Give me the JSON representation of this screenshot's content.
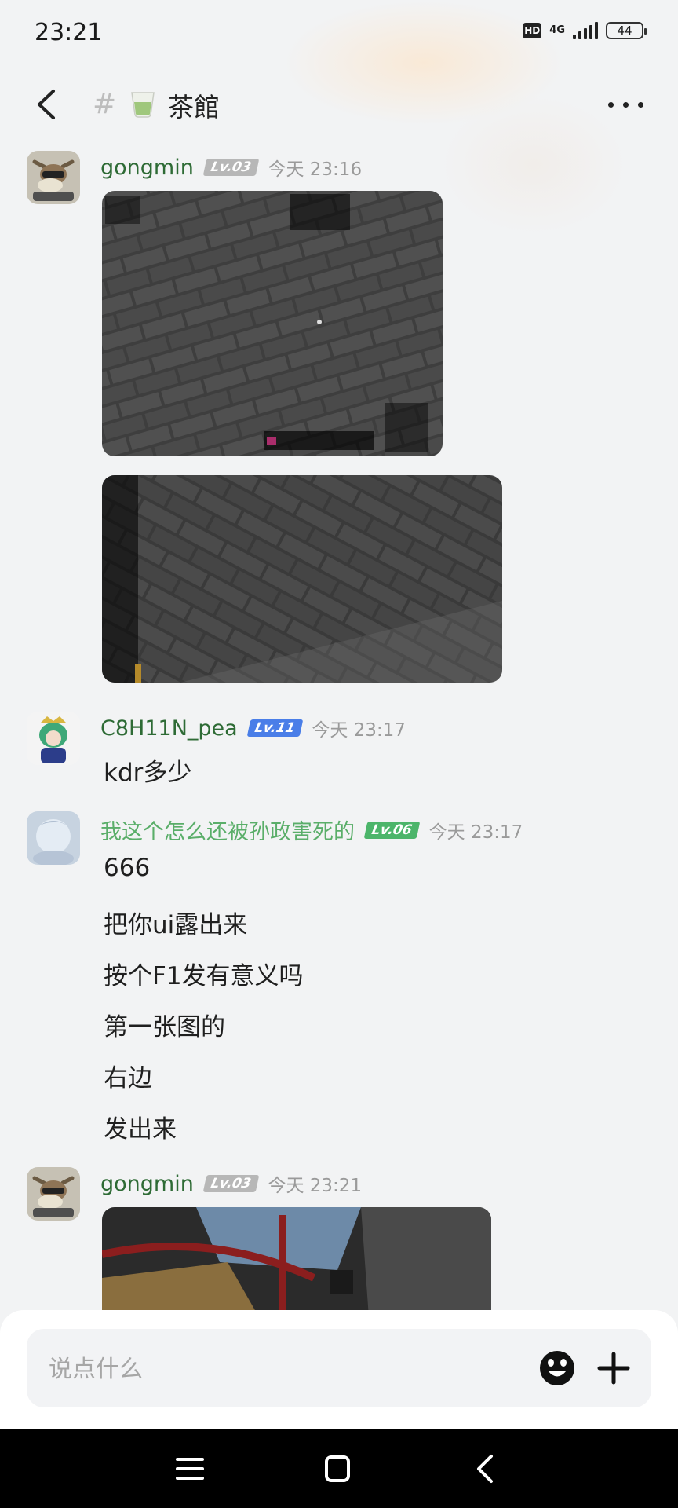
{
  "status_bar": {
    "time": "23:21",
    "hd": "HD",
    "network": "4G",
    "battery": "44"
  },
  "header": {
    "hash": "#",
    "channel_icon": "tea-cup-icon",
    "channel_name": "茶館"
  },
  "messages": [
    {
      "user": "gongmin",
      "level": "Lv.03",
      "level_color": "#b7b7b7",
      "time": "今天 23:16",
      "images": [
        "game-screenshot-1",
        "game-screenshot-2"
      ]
    },
    {
      "user": "C8H11N_pea",
      "level": "Lv.11",
      "level_color": "#4a7ee8",
      "time": "今天 23:17",
      "lines": [
        "kdr多少"
      ]
    },
    {
      "user": "我这个怎么还被孙政害死的",
      "level": "Lv.06",
      "level_color": "#4cb56a",
      "time": "今天 23:17",
      "lines": [
        "666",
        "把你ui露出来",
        "按个F1发有意义吗",
        "第一张图的",
        "右边",
        "发出来"
      ]
    },
    {
      "user": "gongmin",
      "level": "Lv.03",
      "level_color": "#b7b7b7",
      "time": "今天 23:21",
      "images": [
        "game-screenshot-3"
      ]
    }
  ],
  "composer": {
    "placeholder": "说点什么",
    "emoji_icon": "emoji-icon",
    "plus_icon": "plus-icon"
  },
  "nav": {
    "menu_icon": "menu-icon",
    "home_icon": "home-icon",
    "back_icon": "back-icon"
  }
}
